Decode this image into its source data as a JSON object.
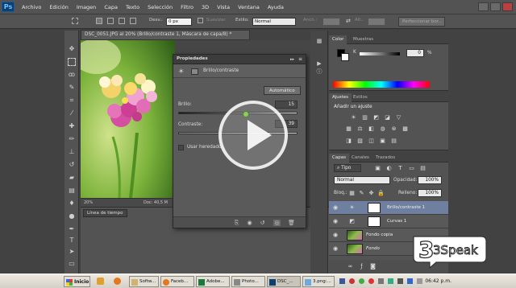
{
  "app": {
    "logo": "Ps",
    "menu": [
      "Archivo",
      "Edición",
      "Imagen",
      "Capa",
      "Texto",
      "Selección",
      "Filtro",
      "3D",
      "Vista",
      "Ventana",
      "Ayuda"
    ]
  },
  "options": {
    "desv_label": "Desv.:",
    "desv_value": "0 px",
    "suavizar_label": "Suavizar",
    "estilo_label": "Estilo:",
    "estilo_value": "Normal",
    "anch_label": "Anch.:",
    "alt_label": "Alt.:",
    "perfeccionar": "Perfeccionar bor..."
  },
  "document": {
    "tab": "DSC_0051.JPG al 20% (Brillo/contraste 1, Máscara de capa/8) *",
    "zoom": "20%",
    "doc_size": "Doc: 40,5 M"
  },
  "timeline": {
    "tab": "Línea de tiempo"
  },
  "properties": {
    "title": "Propiedades",
    "subtitle": "Brillo/contraste",
    "auto_button": "Automático",
    "brillo_label": "Brillo:",
    "brillo_value": "15",
    "contraste_label": "Contraste:",
    "contraste_value": "39",
    "legacy_label": "Usar heredado"
  },
  "color_panel": {
    "tabs": [
      "Color",
      "Muestras"
    ],
    "channel": "K",
    "channel_value": "0",
    "unit": "%"
  },
  "adjust_panel": {
    "tabs": [
      "Ajustes",
      "Estilos"
    ],
    "heading": "Añadir un ajuste"
  },
  "layers_panel": {
    "tabs": [
      "Capas",
      "Canales",
      "Trazados"
    ],
    "kind": "Tipo",
    "blend": "Normal",
    "opacity_label": "Opacidad:",
    "opacity_value": "100%",
    "lock_label": "Bloq.:",
    "fill_label": "Relleno:",
    "fill_value": "100%",
    "layers": [
      {
        "name": "Brillo/contraste 1"
      },
      {
        "name": "Curvas 1"
      },
      {
        "name": "Fondo copia"
      },
      {
        "name": "Fondo"
      }
    ]
  },
  "taskbar": {
    "start": "Inicio",
    "items": [
      "Softw...",
      "Faceb...",
      "Adobe...",
      "Photo...",
      "DSC_...",
      "3.png:..."
    ],
    "clock": "06:42 p.m."
  },
  "watermark": {
    "text": "3Speak"
  }
}
